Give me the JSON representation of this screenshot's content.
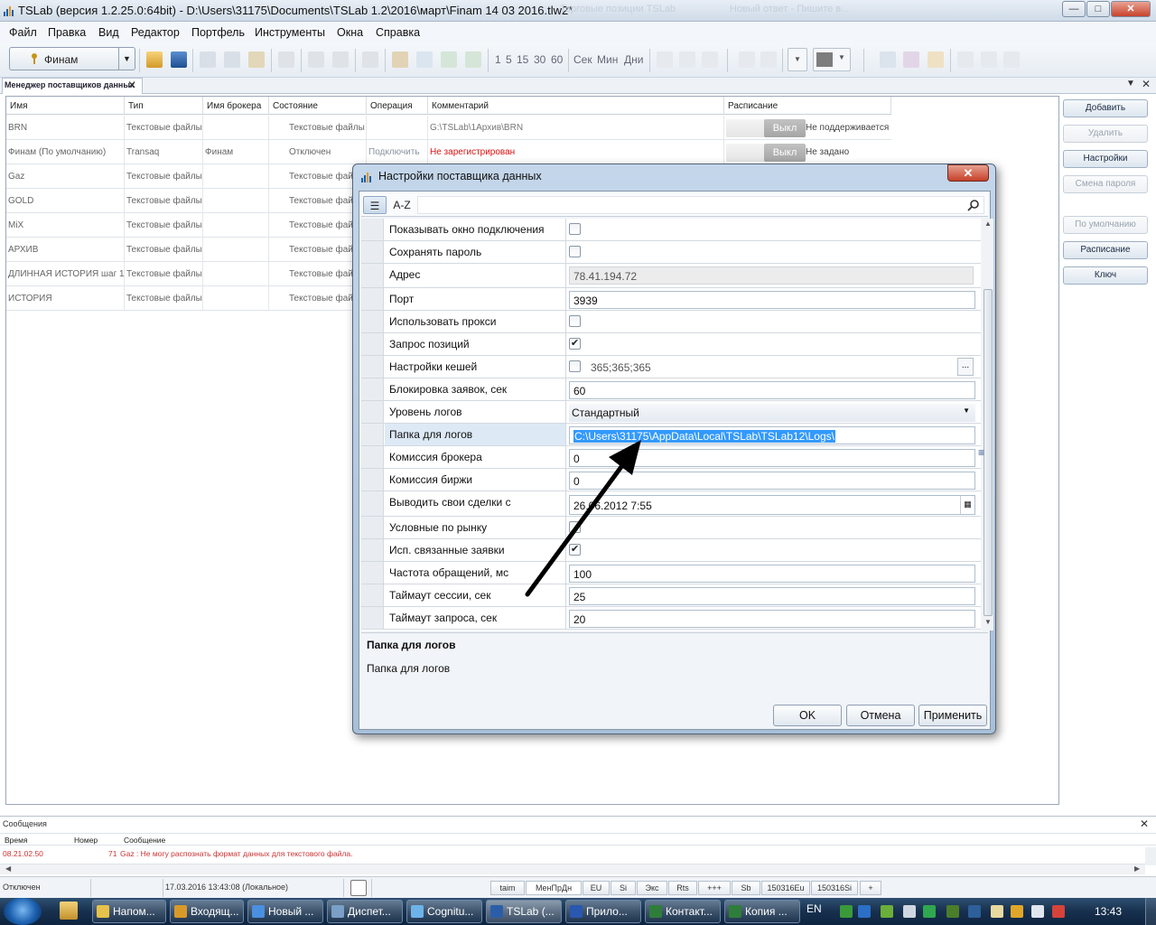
{
  "window": {
    "title": "TSLab (версия 1.2.25.0:64bit) - D:\\Users\\31175\\Documents\\TSLab 1.2\\2016\\март\\Finam 14 03 2016.tlw2*",
    "ghost_title_1": "Торговые позиции TSLab",
    "ghost_title_2": "Новый ответ - Пишите в...",
    "minimize": "—",
    "maximize": "□",
    "close": "✕"
  },
  "menu": [
    "Файл",
    "Правка",
    "Вид",
    "Редактор",
    "Портфель",
    "Инструменты",
    "Окна",
    "Справка"
  ],
  "toolbar": {
    "provider": "Финам",
    "intervals": [
      "1",
      "5",
      "15",
      "30",
      "60"
    ],
    "units": [
      "Сек",
      "Мин",
      "Дни"
    ]
  },
  "panel": {
    "tab_label": "Менеджер поставщиков данных",
    "close": "✕",
    "pin": "▼",
    "close_right": "✕"
  },
  "grid": {
    "columns": [
      "Имя",
      "Тип",
      "Имя брокера",
      "Состояние",
      "Операция",
      "Комментарий",
      "Расписание"
    ],
    "rows": [
      {
        "name": "BRN",
        "type": "Текстовые файлы",
        "broker": "",
        "state": "Текстовые файлы",
        "op": "",
        "comment": "G:\\TSLab\\1Архив\\BRN",
        "switch": "Выкл",
        "schedule": "Не поддерживается"
      },
      {
        "name": "Финам (По умолчанию)",
        "type": "Transaq",
        "broker": "Финам",
        "state": "Отключен",
        "op": "Подключить",
        "comment": "Не зарегистрирован",
        "switch": "Выкл",
        "schedule": "Не задано"
      },
      {
        "name": "Gaz",
        "type": "Текстовые файлы",
        "broker": "",
        "state": "Текстовые фай",
        "op": "",
        "comment": "",
        "switch": "",
        "schedule": ""
      },
      {
        "name": "GOLD",
        "type": "Текстовые файлы",
        "broker": "",
        "state": "Текстовые фай",
        "op": "",
        "comment": "",
        "switch": "",
        "schedule": ""
      },
      {
        "name": "MiX",
        "type": "Текстовые файлы",
        "broker": "",
        "state": "Текстовые фай",
        "op": "",
        "comment": "",
        "switch": "",
        "schedule": ""
      },
      {
        "name": "АРХИВ",
        "type": "Текстовые файлы",
        "broker": "",
        "state": "Текстовые фай",
        "op": "",
        "comment": "",
        "switch": "",
        "schedule": ""
      },
      {
        "name": "ДЛИННАЯ ИСТОРИЯ шаг 1",
        "type": "Текстовые файлы",
        "broker": "",
        "state": "Текстовые фай",
        "op": "",
        "comment": "",
        "switch": "",
        "schedule": ""
      },
      {
        "name": "ИСТОРИЯ",
        "type": "Текстовые файлы",
        "broker": "",
        "state": "Текстовые фай",
        "op": "",
        "comment": "",
        "switch": "",
        "schedule": ""
      }
    ]
  },
  "side_buttons": [
    {
      "label": "Добавить",
      "enabled": true
    },
    {
      "label": "Удалить",
      "enabled": false
    },
    {
      "label": "Настройки",
      "enabled": true
    },
    {
      "label": "Смена пароля",
      "enabled": false
    },
    {
      "label": "По умолчанию",
      "enabled": false
    },
    {
      "label": "Расписание",
      "enabled": true
    },
    {
      "label": "Ключ",
      "enabled": true
    }
  ],
  "messages": {
    "title": "Сообщения",
    "close": "✕",
    "columns": [
      "Время",
      "Номер",
      "Сообщение"
    ],
    "rows": [
      {
        "time": "08.21.02.50",
        "num": "71",
        "text": "Gaz : Не могу распознать формат данных для текстового файла."
      }
    ]
  },
  "status": {
    "state": "Отключен",
    "datetime": "17.03.2016 13:43:08 (Локальное)",
    "tabs": [
      "taim",
      "МенПрДн",
      "EU",
      "Si",
      "Экс",
      "Rts",
      "+++",
      "Sb",
      "150316Eu",
      "150316Si",
      "+"
    ]
  },
  "taskbar": {
    "items": [
      "Напом...",
      "Входящ...",
      "Новый ...",
      "Диспет...",
      "Cognitu...",
      "TSLab (...",
      "Прило...",
      "Контакт...",
      "Копия ..."
    ],
    "lang": "EN",
    "time": "13:43"
  },
  "dialog": {
    "title": "Настройки поставщика данных",
    "close": "✕",
    "sort_category": "☰",
    "sort_az": "A-Z",
    "properties": [
      {
        "name": "Показывать окно подключения",
        "kind": "check",
        "checked": false
      },
      {
        "name": "Сохранять пароль",
        "kind": "check",
        "checked": false
      },
      {
        "name": "Адрес",
        "kind": "text",
        "value": "78.41.194.72",
        "readonly": true
      },
      {
        "name": "Порт",
        "kind": "text",
        "value": "3939"
      },
      {
        "name": "Использовать прокси",
        "kind": "check",
        "checked": false
      },
      {
        "name": "Запрос позиций",
        "kind": "check",
        "checked": true
      },
      {
        "name": "Настройки кешей",
        "kind": "checktext",
        "checked": false,
        "value": "365;365;365"
      },
      {
        "name": "Блокировка заявок, сек",
        "kind": "text",
        "value": "60"
      },
      {
        "name": "Уровень логов",
        "kind": "combo",
        "value": "Стандартный"
      },
      {
        "name": "Папка для логов",
        "kind": "selected",
        "value": "C:\\Users\\31175\\AppData\\Local\\TSLab\\TSLab12\\Logs\\"
      },
      {
        "name": "Комиссия брокера",
        "kind": "text",
        "value": "0"
      },
      {
        "name": "Комиссия биржи",
        "kind": "text",
        "value": "0"
      },
      {
        "name": "Выводить свои сделки с",
        "kind": "date",
        "value": "26.06.2012 7:55"
      },
      {
        "name": "Условные по рынку",
        "kind": "check",
        "checked": false
      },
      {
        "name": "Исп. связанные заявки",
        "kind": "check",
        "checked": true
      },
      {
        "name": "Частота обращений, мс",
        "kind": "text",
        "value": "100"
      },
      {
        "name": "Таймаут сессии, сек",
        "kind": "text",
        "value": "25"
      },
      {
        "name": "Таймаут запроса, сек",
        "kind": "text",
        "value": "20"
      }
    ],
    "desc_title": "Папка для логов",
    "desc_text": "Папка для логов",
    "ok": "OK",
    "cancel": "Отмена",
    "apply": "Применить"
  }
}
